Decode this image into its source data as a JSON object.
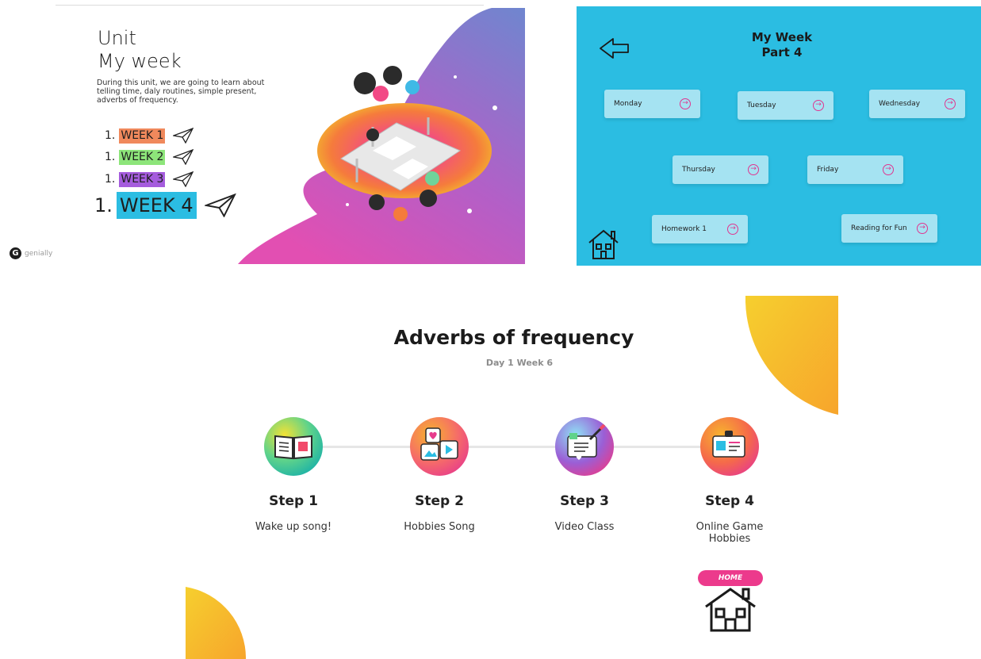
{
  "unit_panel": {
    "title": "Unit",
    "subtitle": "My week",
    "description": "During this unit, we are going to learn about telling time, daly routines, simple present, adverbs of frequency.",
    "weeks": [
      {
        "number": "1.",
        "label": "WEEK 1",
        "color": "#f0895c"
      },
      {
        "number": "1.",
        "label": "WEEK 2",
        "color": "#8de57a"
      },
      {
        "number": "1.",
        "label": "WEEK 3",
        "color": "#a55cdd"
      },
      {
        "number": "1.",
        "label": "WEEK 4",
        "color": "#2bbde2"
      }
    ],
    "brand": "genially",
    "plane_icon": "paper-plane-icon"
  },
  "week_panel": {
    "title_line1": "My Week",
    "title_line2": "Part 4",
    "background": "#2bbde2",
    "buttons": [
      {
        "label": "Monday"
      },
      {
        "label": "Tuesday"
      },
      {
        "label": "Wednesday"
      },
      {
        "label": "Thursday"
      },
      {
        "label": "Friday"
      },
      {
        "label": "Homework 1"
      },
      {
        "label": "Reading for Fun"
      }
    ],
    "arrow_glyph": "→",
    "accent": "#e0358f"
  },
  "adverbs_panel": {
    "title": "Adverbs of frequency",
    "subtitle": "Day 1 Week 6",
    "steps": [
      {
        "name": "Step 1",
        "desc": "Wake up song!",
        "icon": "book-icon"
      },
      {
        "name": "Step 2",
        "desc": "Hobbies Song",
        "icon": "media-tiles-icon"
      },
      {
        "name": "Step 3",
        "desc": "Video Class",
        "icon": "paint-brush-icon"
      },
      {
        "name": "Step 4",
        "desc": "Online Game Hobbies",
        "icon": "id-card-icon"
      }
    ],
    "home_label": "HOME",
    "accent": "#f7b22e"
  }
}
